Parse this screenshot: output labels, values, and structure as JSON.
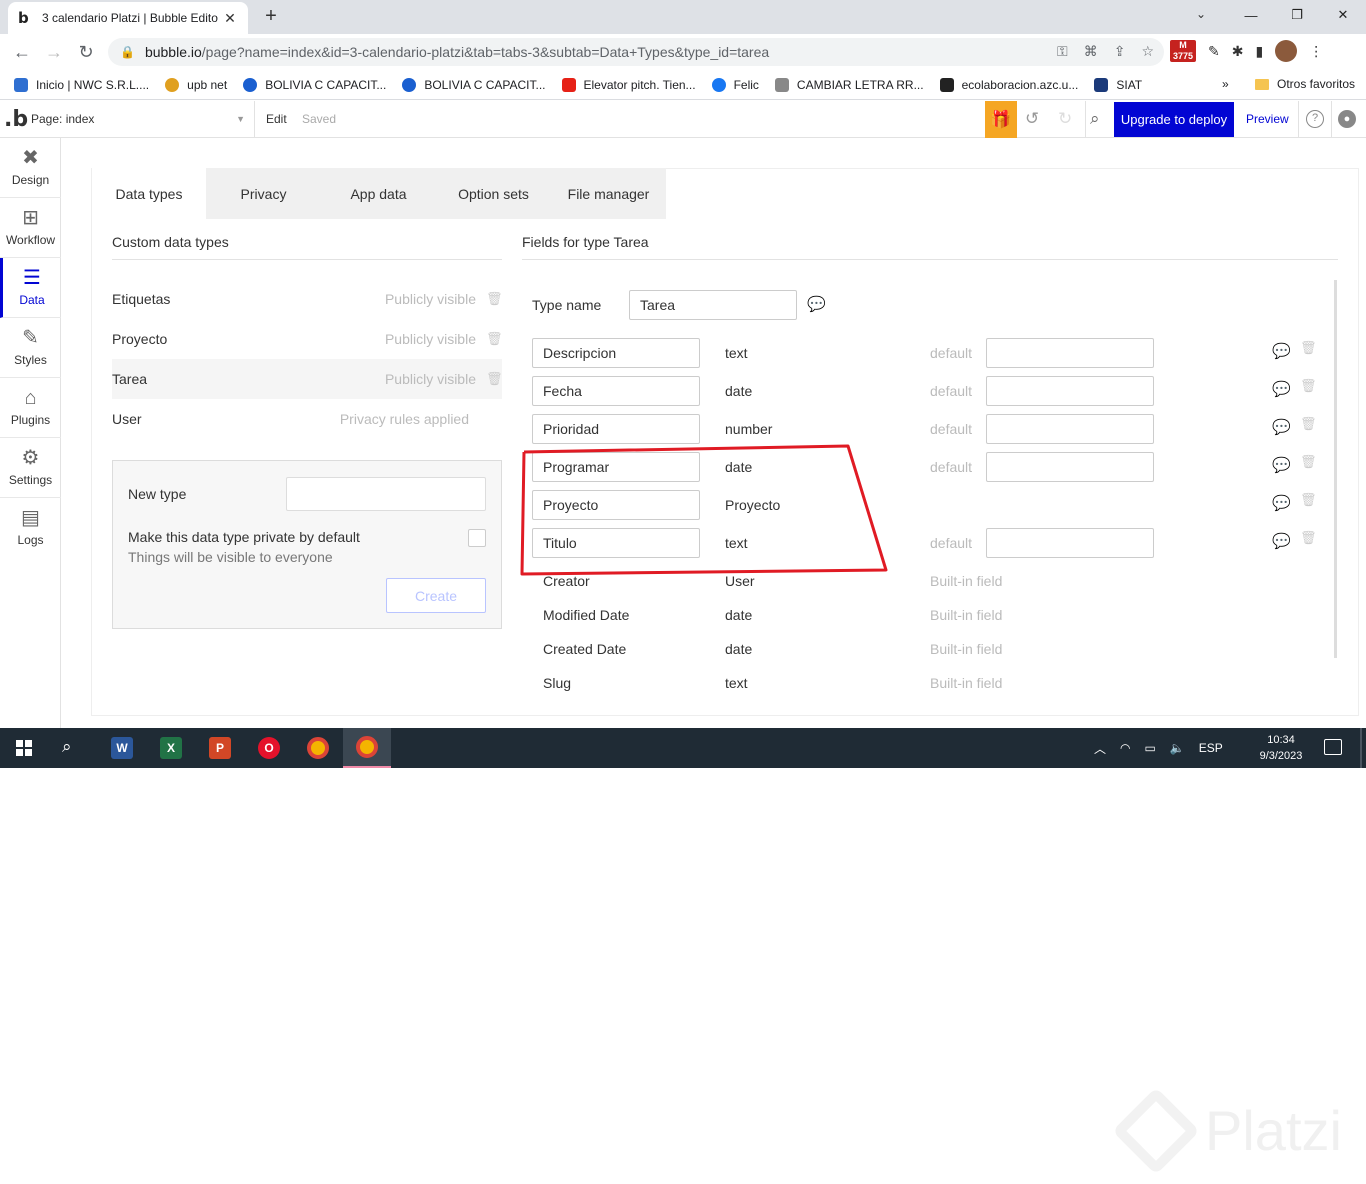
{
  "browser": {
    "tab_title": "3 calendario Platzi | Bubble Edito",
    "tab_favicon": "b",
    "url_host": "bubble.io",
    "url_rest": "/page?name=index&id=3-calendario-platzi&tab=tabs-3&subtab=Data+Types&type_id=tarea",
    "gmail_badge": "3775",
    "bookmarks": [
      {
        "label": "Inicio | NWC S.R.L....",
        "color": "#2f6fd1"
      },
      {
        "label": "upb net",
        "color": "#e0a020"
      },
      {
        "label": "BOLIVIA C CAPACIT...",
        "color": "#1a5fd0"
      },
      {
        "label": "BOLIVIA C CAPACIT...",
        "color": "#1a5fd0"
      },
      {
        "label": "Elevator pitch. Tien...",
        "color": "#e62117"
      },
      {
        "label": "Felic",
        "color": "#1877f2"
      },
      {
        "label": "CAMBIAR LETRA RR...",
        "color": "#888888"
      },
      {
        "label": "ecolaboracion.azc.u...",
        "color": "#222222"
      },
      {
        "label": "SIAT",
        "color": "#1b3a7a"
      }
    ],
    "more_bookmarks": "»",
    "other_bookmarks": "Otros favoritos"
  },
  "editor": {
    "page_label": "Page: index",
    "edit_label": "Edit",
    "saved_label": "Saved",
    "upgrade_label": "Upgrade to deploy",
    "preview_label": "Preview",
    "accent": "#0205d3",
    "gift_color": "#f5a623"
  },
  "leftnav": {
    "items": [
      {
        "label": "Design",
        "icon": "design-icon"
      },
      {
        "label": "Workflow",
        "icon": "workflow-icon"
      },
      {
        "label": "Data",
        "icon": "database-icon"
      },
      {
        "label": "Styles",
        "icon": "brush-icon"
      },
      {
        "label": "Plugins",
        "icon": "plugin-icon"
      },
      {
        "label": "Settings",
        "icon": "gear-icon"
      },
      {
        "label": "Logs",
        "icon": "document-icon"
      }
    ]
  },
  "subtabs": [
    "Data types",
    "Privacy",
    "App data",
    "Option sets",
    "File manager"
  ],
  "custom_types": {
    "title": "Custom data types",
    "items": [
      {
        "name": "Etiquetas",
        "visibility": "Publicly visible"
      },
      {
        "name": "Proyecto",
        "visibility": "Publicly visible"
      },
      {
        "name": "Tarea",
        "visibility": "Publicly visible"
      },
      {
        "name": "User",
        "visibility": "Privacy rules applied"
      }
    ]
  },
  "new_type": {
    "label": "New type",
    "input_value": "",
    "private_label": "Make this data type private by default",
    "private_hint": "Things will be visible to everyone",
    "create_label": "Create"
  },
  "fields": {
    "title": "Fields for type Tarea",
    "type_name_label": "Type name",
    "type_name_value": "Tarea",
    "default_label": "default",
    "builtin_label": "Built-in field",
    "custom": [
      {
        "name": "Descripcion",
        "type": "text"
      },
      {
        "name": "Fecha",
        "type": "date"
      },
      {
        "name": "Prioridad",
        "type": "number"
      },
      {
        "name": "Programar",
        "type": "date"
      },
      {
        "name": "Proyecto",
        "type": "Proyecto"
      },
      {
        "name": "Titulo",
        "type": "text"
      }
    ],
    "builtin": [
      {
        "name": "Creator",
        "type": "User"
      },
      {
        "name": "Modified Date",
        "type": "date"
      },
      {
        "name": "Created Date",
        "type": "date"
      },
      {
        "name": "Slug",
        "type": "text"
      }
    ]
  },
  "taskbar": {
    "language": "ESP",
    "time": "10:34",
    "date": "9/3/2023"
  },
  "watermark": "Platzi"
}
